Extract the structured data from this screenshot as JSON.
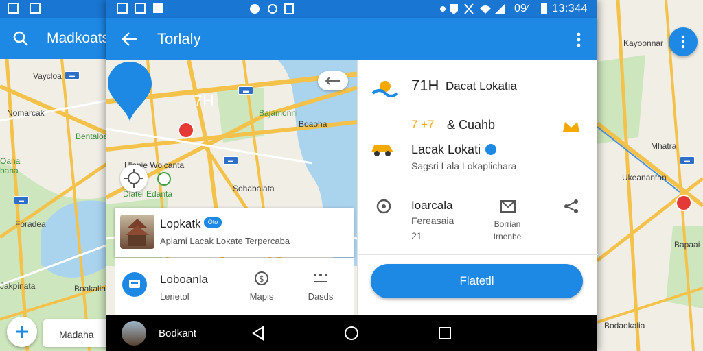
{
  "left_panel": {
    "appbar_title": "Madkoats",
    "map_labels": [
      "Vaycloa",
      "Nomarcak",
      "Bentaloa",
      "Oana",
      "bana",
      "Foradea",
      "Jakpinata",
      "Boakaliaa"
    ],
    "chip_label": "Madaha"
  },
  "status_bar": {
    "time": "13:344",
    "battery": "09∕"
  },
  "app_bar": {
    "title": "Torlaly"
  },
  "map": {
    "pin_label": "7H",
    "labels": [
      "Hlanie Wolcanta",
      "Diatel Edanta",
      "Bajamonni",
      "Boaoha",
      "Sohabalata"
    ]
  },
  "place_card": {
    "title": "Lopkatk",
    "badge": "Oto",
    "subtitle": "Aplami Lacak Lokate Terpercaba"
  },
  "action_row": {
    "title": "Loboanla",
    "subtitle": "Lerietol",
    "buttons": [
      {
        "label": "Mapis",
        "icon": "dollar-circle-icon"
      },
      {
        "label": "Dasds",
        "icon": "grid-dots-icon"
      }
    ]
  },
  "info_panel": {
    "row1_main": "71H",
    "row1_rest": "Dacat Lokatia",
    "rating": "7 +7",
    "rating_title": "& Cuahb",
    "location_title": "Lacak Lokati",
    "location_sub": "Sagsri Lala Lokaplichara",
    "row3_title": "Ioarcala",
    "row3_sub": "Fereasaia",
    "row3_num": "21",
    "row3_col2": [
      "Borrian",
      "Irnenhe"
    ],
    "cta_label": "Flatetll"
  },
  "nav_bar": {
    "label": "Bodkant"
  },
  "right_panel": {
    "labels": [
      "Kayoonnar",
      "Mhatra",
      "Ukeanantan",
      "Bapaai",
      "Bodaokalia"
    ]
  },
  "colors": {
    "primary": "#1e88e5",
    "status": "#1976d2",
    "road": "#f4c24b",
    "park": "#cde6bd",
    "water": "#aad3ee"
  }
}
